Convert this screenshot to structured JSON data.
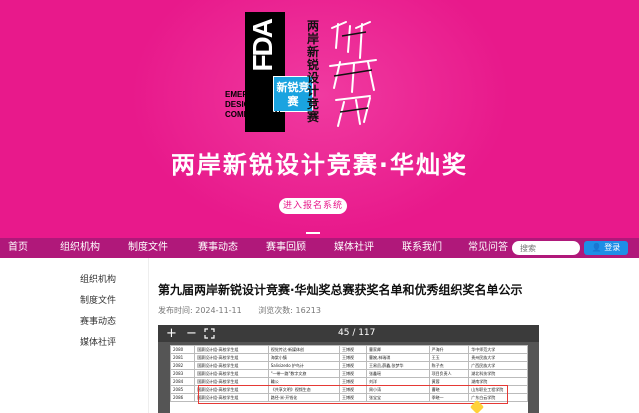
{
  "banner": {
    "title": "两岸新锐设计竞赛·华灿奖",
    "logo_letters": "FDA",
    "logo_badge": "新锐竞赛",
    "logo_emerge_lines": [
      "EMERGING",
      "DESIGN",
      "COMPETITION"
    ],
    "logo_vertical": "两岸新锐设计竞赛",
    "register_button": "进入报名系统",
    "brand_color": "#e8198b"
  },
  "nav": {
    "items": [
      "首页",
      "组织机构",
      "制度文件",
      "赛事动态",
      "赛事回顾",
      "媒体社评",
      "联系我们",
      "常见问答"
    ],
    "search_placeholder": "搜索",
    "login_label": "登录",
    "bar_color": "#b0187a"
  },
  "sidebar": {
    "items": [
      "组织机构",
      "制度文件",
      "赛事动态",
      "媒体社评"
    ]
  },
  "article": {
    "title": "第九届两岸新锐设计竞赛·华灿奖总赛获奖名单和优秀组织奖名单公示",
    "publish_time": "发布时间: 2024-11-11",
    "views": "浏览次数: 16213"
  },
  "viewer": {
    "zoom_in": "+",
    "zoom_out": "−",
    "fullscreen_icon": "fullscreen-icon",
    "page_indicator": "45 / 117",
    "rows": [
      [
        "2080",
        "国赛设计组-高校学生组",
        "视觉传达·新媒体创",
        "王博视",
        "曹家卿",
        "严海升",
        "华中师范大学"
      ],
      [
        "2081",
        "国赛设计组-高校学生组",
        "海棠小镇",
        "王博视",
        "曹婉,林瑞琪",
        "王玉",
        "贵州民族大学"
      ],
      [
        "2082",
        "国赛设计组-高校学生组",
        "Salisizedo 护鸟计",
        "王博视",
        "王易员,薛鑫,张梦华",
        "陈子杰",
        "广西民族大学"
      ],
      [
        "2083",
        "国赛设计组-高校学生组",
        "\"一带一路\"数字文旅",
        "王博视",
        "张鑫瑶",
        "项目负责人",
        "湖北科技学院"
      ],
      [
        "2084",
        "国赛设计组-高校学生组",
        "輪公",
        "王博视",
        "刘洋",
        "黄蓉",
        "湖南学院"
      ],
      [
        "2085",
        "国赛设计组-高校学生组",
        "《共享文明》视频生态",
        "王博视",
        "周小涛",
        "曹晓",
        "山东职业工程学院"
      ],
      [
        "2086",
        "国赛设计组-高校学生组",
        "路径·米·开钱化",
        "王博视",
        "张宝宝",
        "季晓一",
        "广东白云学院"
      ]
    ]
  }
}
